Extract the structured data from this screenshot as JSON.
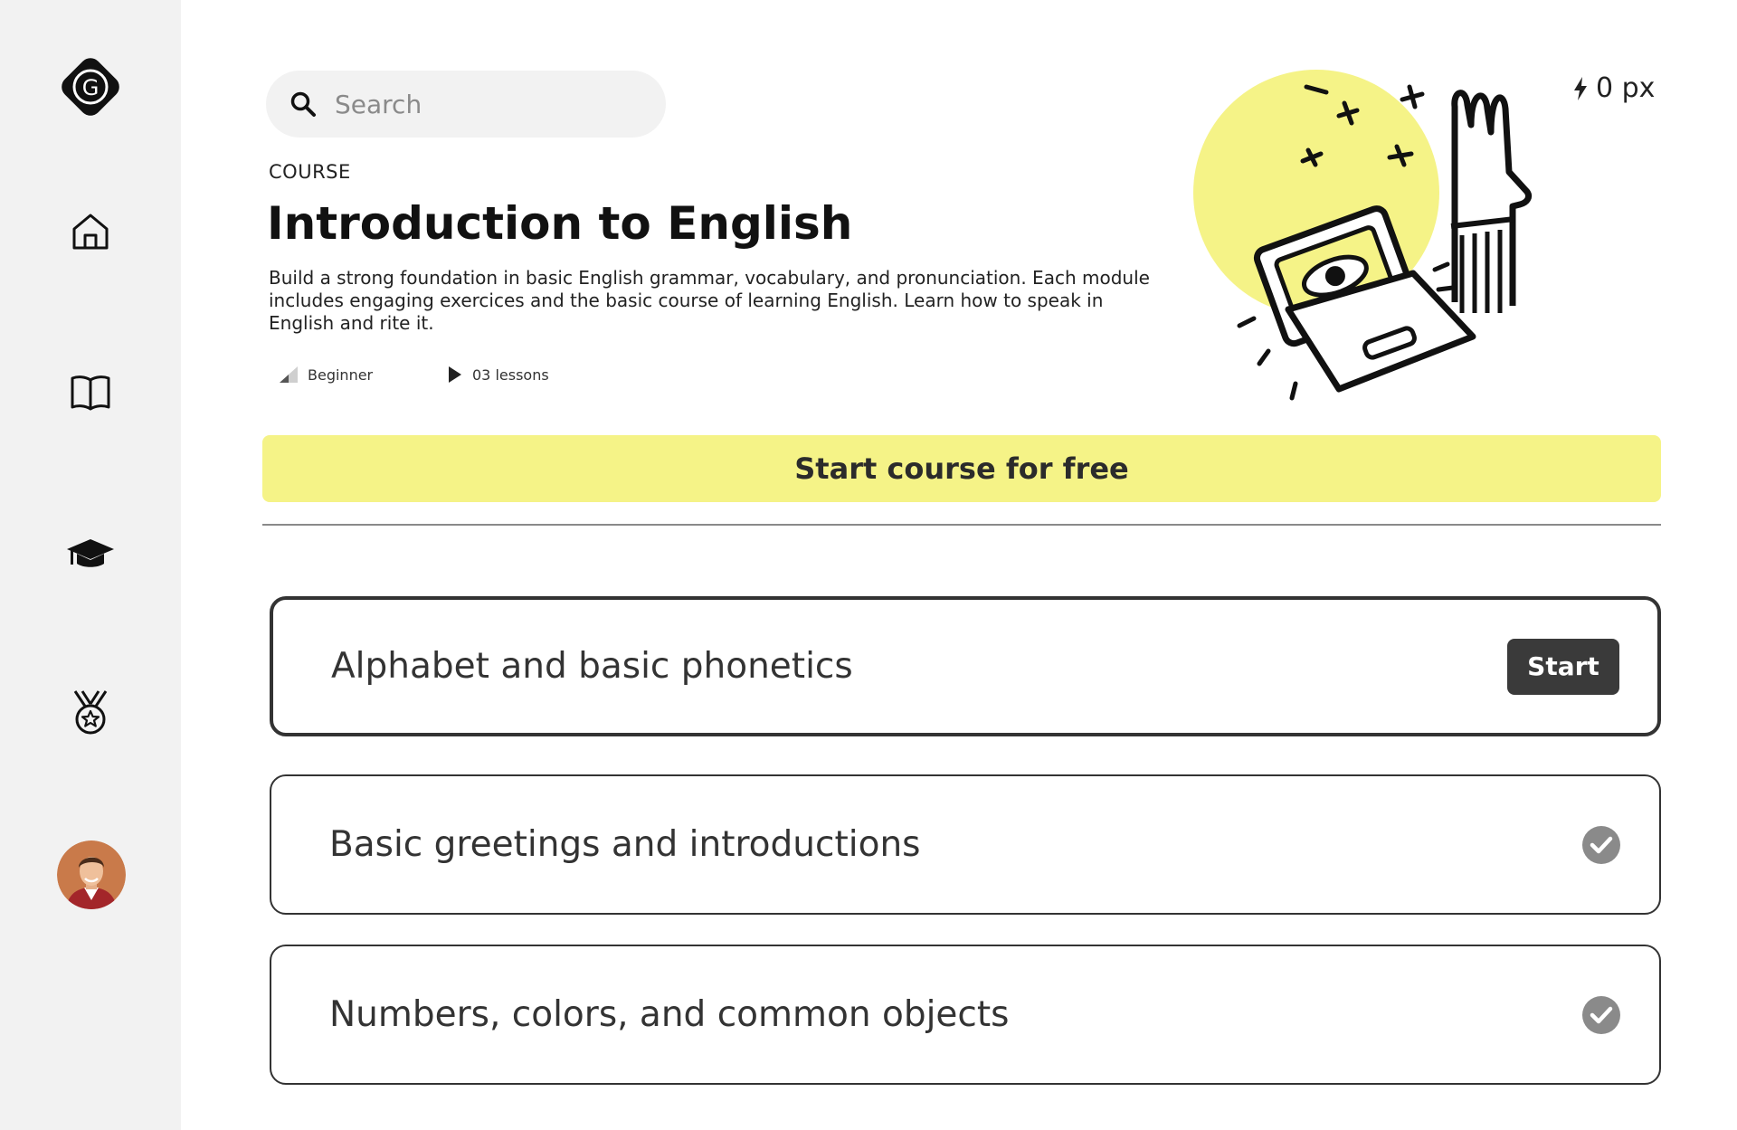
{
  "sidebar": {
    "logo_letter": "G",
    "nav": [
      {
        "icon": "home-icon"
      },
      {
        "icon": "book-icon"
      },
      {
        "icon": "graduation-cap-icon"
      },
      {
        "icon": "medal-icon"
      }
    ],
    "avatar": "user-avatar"
  },
  "search": {
    "placeholder": "Search"
  },
  "xp": {
    "value": "0 px"
  },
  "course": {
    "eyebrow": "COURSE",
    "title": "Introduction to English",
    "description": "Build a strong foundation in basic English grammar, vocabulary, and pronunciation. Each module includes engaging exercices and the basic course of learning English. Learn how to speak in English and rite it.",
    "level": "Beginner",
    "lessons_count": "03 lessons"
  },
  "cta": {
    "label": "Start course for free"
  },
  "lessons": [
    {
      "title": "Alphabet and basic phonetics",
      "action": "Start",
      "status": "current"
    },
    {
      "title": "Basic greetings and introductions",
      "status": "completed"
    },
    {
      "title": "Numbers, colors, and common objects",
      "status": "completed"
    }
  ],
  "colors": {
    "accent": "#f5f387",
    "sidebar_bg": "#f2f2f2",
    "button_dark": "#3a3a3a",
    "check": "#8a8a8a"
  }
}
